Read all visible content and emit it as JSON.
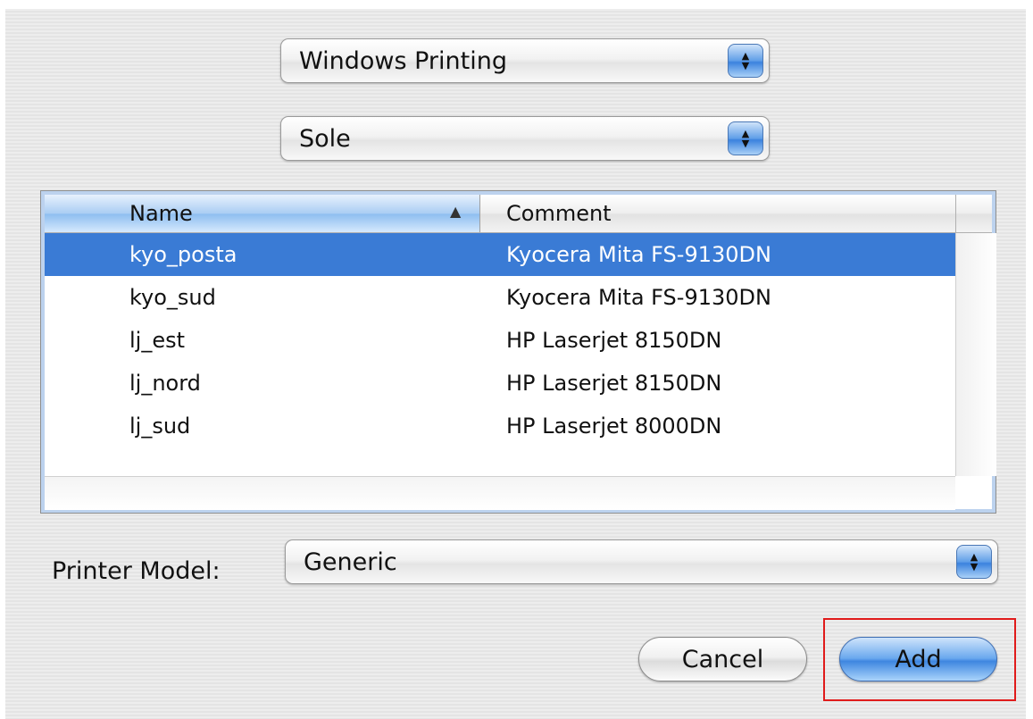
{
  "service_popup": {
    "value": "Windows Printing"
  },
  "workgroup_popup": {
    "value": "Sole"
  },
  "printer_table": {
    "columns": [
      "Name",
      "Comment"
    ],
    "sort_indicator": "▲",
    "rows": [
      {
        "name": "kyo_posta",
        "comment": "Kyocera Mita FS-9130DN",
        "selected": true
      },
      {
        "name": "kyo_sud",
        "comment": "Kyocera Mita FS-9130DN",
        "selected": false
      },
      {
        "name": "lj_est",
        "comment": "HP Laserjet 8150DN",
        "selected": false
      },
      {
        "name": "lj_nord",
        "comment": "HP Laserjet 8150DN",
        "selected": false
      },
      {
        "name": "lj_sud",
        "comment": "HP Laserjet 8000DN",
        "selected": false
      }
    ]
  },
  "printer_model": {
    "label": "Printer Model:",
    "value": "Generic"
  },
  "buttons": {
    "cancel": "Cancel",
    "add": "Add"
  },
  "colors": {
    "selection": "#3a7bd5",
    "highlight_box": "#e01b1b"
  }
}
